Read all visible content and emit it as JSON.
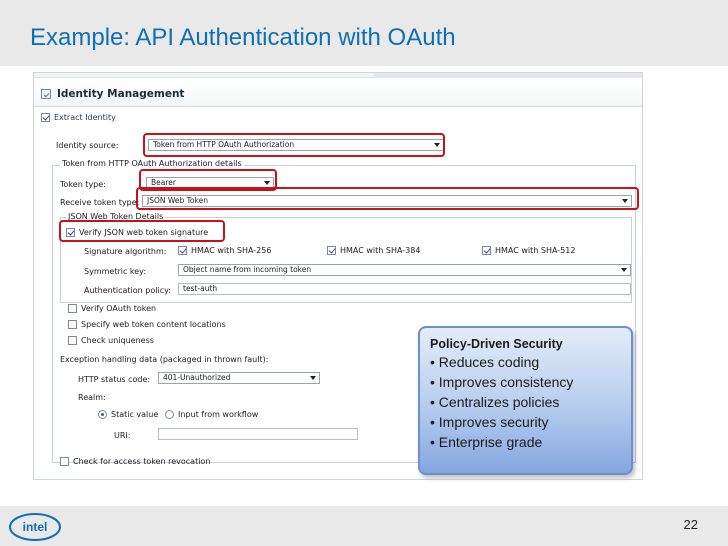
{
  "slide": {
    "title": "Example: API Authentication with OAuth",
    "page_number": "22",
    "logo_text": "intel"
  },
  "pane": {
    "title": "Identity Management",
    "section_label": "Extract Identity",
    "identity_source_label": "Identity source:",
    "identity_source_value": "Token from HTTP OAuth Authorization",
    "details_group_title": "Token from HTTP OAuth Authorization details",
    "token_type_label": "Token type:",
    "token_type_value": "Bearer",
    "receive_token_type_label": "Receive token type:",
    "receive_token_type_value": "JSON Web Token",
    "jwt_group_title": "JSON Web Token Details",
    "verify_jwt_signature_label": "Verify JSON web token signature",
    "signature_algorithm_label": "Signature algorithm:",
    "algorithms": [
      {
        "label": "HMAC with SHA-256",
        "checked": true
      },
      {
        "label": "HMAC with SHA-384",
        "checked": true
      },
      {
        "label": "HMAC with SHA-512",
        "checked": true
      }
    ],
    "symmetric_key_label": "Symmetric key:",
    "symmetric_key_value": "Object name from incoming token",
    "auth_policy_label": "Authentication policy:",
    "auth_policy_value": "test-auth",
    "verify_oauth_label": "Verify OAuth token",
    "specify_locations_label": "Specify web token content locations",
    "check_uniqueness_label": "Check uniqueness",
    "exception_label": "Exception handling data (packaged in thrown fault):",
    "http_status_label": "HTTP status code:",
    "http_status_value": "401-Unauthorized",
    "realm_label": "Realm:",
    "static_value_label": "Static value",
    "input_workflow_label": "Input from workflow",
    "uri_label": "URI:",
    "uri_value": "",
    "revocation_label": "Check for access token revocation"
  },
  "callout": {
    "title": "Policy-Driven Security",
    "items": [
      "• Reduces coding",
      "• Improves consistency",
      "• Centralizes policies",
      "• Improves security",
      "• Enterprise grade"
    ]
  },
  "colors": {
    "title_blue": "#0f6fb6",
    "highlight_red": "#c5121c",
    "callout_border": "#6d8fd1",
    "bar_gray": "#e9e9e9"
  }
}
